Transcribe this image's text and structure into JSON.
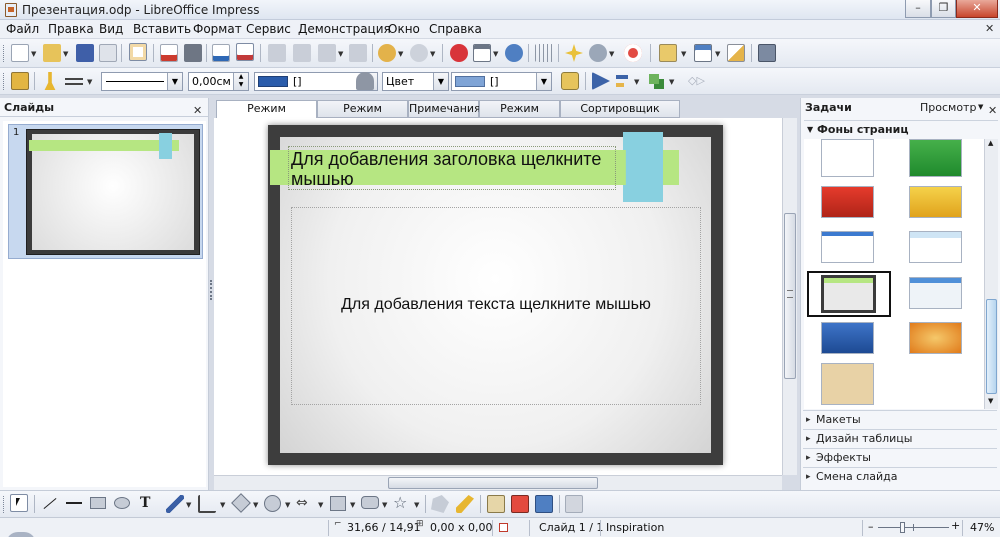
{
  "window": {
    "title": "Презентация.odp - LibreOffice Impress",
    "minimize": "–",
    "restore": "❐",
    "close": "✕"
  },
  "menu": [
    "Файл",
    "Правка",
    "Вид",
    "Вставить",
    "Формат",
    "Сервис",
    "Демонстрация",
    "Окно",
    "Справка"
  ],
  "menu_close": "✕",
  "line_props": {
    "width_value": "0,00см",
    "area_style": "Цвет",
    "line_color_value": "[]",
    "fill_color_value": "[]"
  },
  "slides_panel": {
    "title": "Слайды",
    "close": "✕",
    "items": [
      {
        "number": "1"
      }
    ]
  },
  "view_tabs": [
    {
      "label": "Режим рисования",
      "active": true
    },
    {
      "label": "Режим структуры",
      "active": false
    },
    {
      "label": "Примечания",
      "active": false
    },
    {
      "label": "Режим тезисов",
      "active": false
    },
    {
      "label": "Сортировщик слайдов",
      "active": false
    }
  ],
  "slide": {
    "title_placeholder": "Для добавления заголовка щелкните мышью",
    "content_placeholder": "Для добавления текста щелкните мышью"
  },
  "tasks_panel": {
    "title": "Задачи",
    "view_menu": "Просмотр",
    "close": "✕",
    "expanded_section": "Фоны страниц",
    "sections": [
      "Макеты",
      "Дизайн таблицы",
      "Эффекты",
      "Смена слайда"
    ]
  },
  "statusbar": {
    "position": "31,66 / 14,91",
    "size": "0,00 x 0,00",
    "slide_info": "Слайд 1 / 1",
    "master": "Inspiration",
    "zoom_minus": "–",
    "zoom_plus": "+",
    "zoom": "47%"
  },
  "colors": {
    "accent_green": "#b6e682",
    "accent_blue": "#88d0e0",
    "line_color": "#2a5cab",
    "fill_color": "#7fa4d6"
  }
}
